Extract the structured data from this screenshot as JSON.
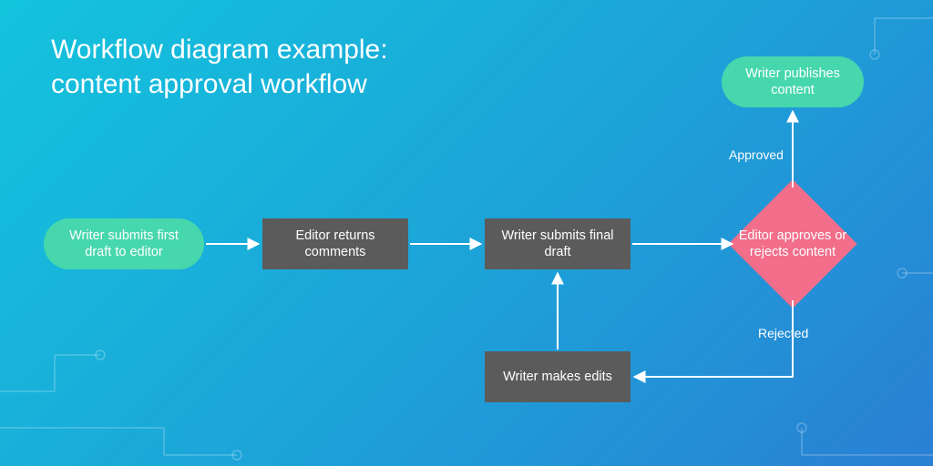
{
  "title": {
    "line1": "Workflow diagram example:",
    "line2": "content approval workflow"
  },
  "nodes": {
    "start": {
      "label": "Writer submits first draft to editor"
    },
    "review": {
      "label": "Editor returns comments"
    },
    "final": {
      "label": "Writer submits final draft"
    },
    "edits": {
      "label": "Writer makes edits"
    },
    "decision": {
      "label": "Editor approves or rejects content"
    },
    "publish": {
      "label": "Writer publishes content"
    }
  },
  "edgeLabels": {
    "approved": "Approved",
    "rejected": "Rejected"
  },
  "colors": {
    "pill": "#47d7ac",
    "rect": "#5b5b5b",
    "diamond": "#f26e8a",
    "bgFrom": "#13c4dd",
    "bgTo": "#2a7fd3"
  }
}
